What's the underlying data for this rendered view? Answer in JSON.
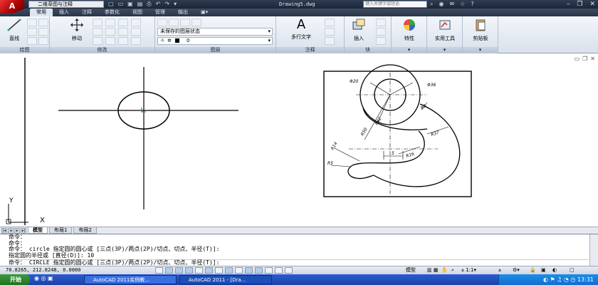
{
  "titlebar": {
    "workspace": "二维草图与注释",
    "title": "Drawing5.dwg",
    "search_placeholder": "键入关键字或短语",
    "window_controls": [
      "minimize-icon",
      "restore-icon",
      "close-icon"
    ]
  },
  "ribbon_tabs": [
    "常用",
    "插入",
    "注释",
    "参数化",
    "视图",
    "管理",
    "输出"
  ],
  "ribbon": {
    "draw": {
      "line": "直线",
      "label": "绘图"
    },
    "modify": {
      "move": "移动",
      "label": "修改"
    },
    "layers": {
      "state": "未保存的图层状态",
      "current_layer": "0",
      "label": "图层"
    },
    "annotation": {
      "mtext": "多行文字",
      "label": "注释"
    },
    "block": {
      "insert": "插入",
      "label": "块"
    },
    "properties": {
      "label": "特性"
    },
    "utilities": {
      "label": "实用工具"
    },
    "clipboard": {
      "label": "剪贴板"
    }
  },
  "drawing": {
    "dims": [
      "Φ20",
      "Φ36",
      "R8",
      "R42",
      "R50",
      "R37",
      "R16",
      "R14",
      "R5",
      "5"
    ],
    "ucs": {
      "y": "Y",
      "x": "X"
    }
  },
  "layout_tabs": [
    "模型",
    "布局1",
    "布局2"
  ],
  "command": {
    "lines": [
      "命令：",
      "命令：",
      "命令：  circle 指定圆的圆心或 [三点(3P)/两点(2P)/切点、切点、半径(T)]:",
      "指定圆的半径或 [直径(D)]: 10"
    ],
    "prompt": "命令：  CIRCLE 指定圆的圆心或 [三点(3P)/两点(2P)/切点、切点、半径(T)]:"
  },
  "statusbar": {
    "coords": "70.8265,  212.8248,  0.0000",
    "model": "模型",
    "annoscale": "1:1"
  },
  "taskbar": {
    "start": "开始",
    "tasks": [
      "AutoCAD 2011实例教...",
      "AutoCAD 2011 - [Dra..."
    ],
    "clock": "13:31"
  },
  "colors": {
    "titlebar": "#1c2737",
    "taskbar": "#1c42a8",
    "start": "#2f8a2f",
    "ucs_green": "#1aa01a"
  }
}
